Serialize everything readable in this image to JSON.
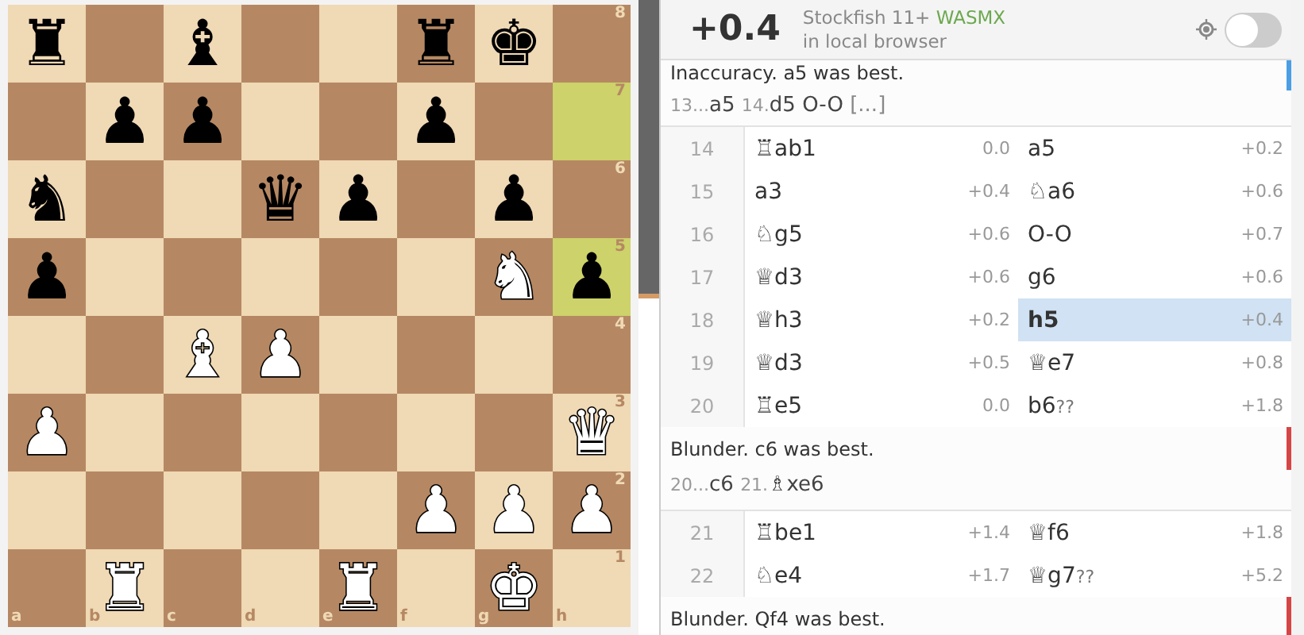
{
  "board": {
    "ranks": [
      {
        "label": "8",
        "squares": [
          {
            "piece": "♜",
            "white": false,
            "highlighted": false
          },
          {
            "highlighted": false
          },
          {
            "piece": "♝",
            "white": false,
            "highlighted": false
          },
          {
            "highlighted": false
          },
          {
            "highlighted": false
          },
          {
            "piece": "♜",
            "white": false,
            "highlighted": false
          },
          {
            "piece": "♚",
            "white": false,
            "highlighted": false
          },
          {
            "highlighted": false
          }
        ]
      },
      {
        "label": "7",
        "squares": [
          {
            "highlighted": false
          },
          {
            "piece": "♟",
            "white": false,
            "highlighted": false
          },
          {
            "piece": "♟",
            "white": false,
            "highlighted": false
          },
          {
            "highlighted": false
          },
          {
            "highlighted": false
          },
          {
            "piece": "♟",
            "white": false,
            "highlighted": false
          },
          {
            "highlighted": false
          },
          {
            "highlighted": true
          }
        ]
      },
      {
        "label": "6",
        "squares": [
          {
            "piece": "♞",
            "white": false,
            "highlighted": false
          },
          {
            "highlighted": false
          },
          {
            "highlighted": false
          },
          {
            "piece": "♛",
            "white": false,
            "highlighted": false
          },
          {
            "piece": "♟",
            "white": false,
            "highlighted": false
          },
          {
            "highlighted": false
          },
          {
            "piece": "♟",
            "white": false,
            "highlighted": false
          },
          {
            "highlighted": false
          }
        ]
      },
      {
        "label": "5",
        "squares": [
          {
            "piece": "♟",
            "white": false,
            "highlighted": false
          },
          {
            "highlighted": false
          },
          {
            "highlighted": false
          },
          {
            "highlighted": false
          },
          {
            "highlighted": false
          },
          {
            "highlighted": false
          },
          {
            "piece": "♞",
            "white": true,
            "highlighted": false
          },
          {
            "piece": "♟",
            "white": false,
            "highlighted": true
          }
        ]
      },
      {
        "label": "4",
        "squares": [
          {
            "highlighted": false
          },
          {
            "highlighted": false
          },
          {
            "piece": "♝",
            "white": true,
            "highlighted": false
          },
          {
            "piece": "♟",
            "white": true,
            "highlighted": false
          },
          {
            "highlighted": false
          },
          {
            "highlighted": false
          },
          {
            "highlighted": false
          },
          {
            "highlighted": false
          }
        ]
      },
      {
        "label": "3",
        "squares": [
          {
            "piece": "♟",
            "white": true,
            "highlighted": false
          },
          {
            "highlighted": false
          },
          {
            "highlighted": false
          },
          {
            "highlighted": false
          },
          {
            "highlighted": false
          },
          {
            "highlighted": false
          },
          {
            "highlighted": false
          },
          {
            "piece": "♛",
            "white": true,
            "highlighted": false
          }
        ]
      },
      {
        "label": "2",
        "squares": [
          {
            "highlighted": false
          },
          {
            "highlighted": false
          },
          {
            "highlighted": false
          },
          {
            "highlighted": false
          },
          {
            "highlighted": false
          },
          {
            "piece": "♟",
            "white": true,
            "highlighted": false
          },
          {
            "piece": "♟",
            "white": true,
            "highlighted": false
          },
          {
            "piece": "♟",
            "white": true,
            "highlighted": false
          }
        ]
      },
      {
        "label": "1",
        "squares": [
          {
            "highlighted": false
          },
          {
            "piece": "♜",
            "white": true,
            "highlighted": false
          },
          {
            "highlighted": false
          },
          {
            "highlighted": false
          },
          {
            "piece": "♜",
            "white": true,
            "highlighted": false
          },
          {
            "highlighted": false
          },
          {
            "piece": "♚",
            "white": true,
            "highlighted": false
          },
          {
            "highlighted": false
          }
        ]
      }
    ],
    "files": [
      "a",
      "b",
      "c",
      "d",
      "e",
      "f",
      "g",
      "h"
    ]
  },
  "eval_bar": {
    "level": 0.53
  },
  "engine": {
    "eval": "+0.4",
    "name": "Stockfish 11+",
    "variant": "WASMX",
    "location": "in local browser",
    "enabled": false
  },
  "moves": [
    {
      "kind": "comment",
      "color": "#4a9ee3",
      "text": "Inaccuracy. a5 was best.",
      "line": [
        {
          "kind": "num",
          "text": "13..."
        },
        {
          "kind": "san",
          "text": "a5"
        },
        {
          "kind": "num",
          "text": "14."
        },
        {
          "kind": "san",
          "text": "d5"
        },
        {
          "kind": "san",
          "text": "O-O"
        },
        {
          "kind": "more",
          "text": "[...]"
        }
      ]
    },
    {
      "kind": "row",
      "number": "14",
      "white": {
        "san": "♖ab1",
        "eval": "0.0",
        "selected": false
      },
      "black": {
        "san": "a5",
        "eval": "+0.2",
        "selected": false
      }
    },
    {
      "kind": "row",
      "number": "15",
      "white": {
        "san": "a3",
        "eval": "+0.4",
        "selected": false
      },
      "black": {
        "san": "♘a6",
        "eval": "+0.6",
        "selected": false
      }
    },
    {
      "kind": "row",
      "number": "16",
      "white": {
        "san": "♘g5",
        "eval": "+0.6",
        "selected": false
      },
      "black": {
        "san": "O-O",
        "eval": "+0.7",
        "selected": false
      }
    },
    {
      "kind": "row",
      "number": "17",
      "white": {
        "san": "♕d3",
        "eval": "+0.6",
        "selected": false
      },
      "black": {
        "san": "g6",
        "eval": "+0.6",
        "selected": false
      }
    },
    {
      "kind": "row",
      "number": "18",
      "white": {
        "san": "♕h3",
        "eval": "+0.2",
        "selected": false
      },
      "black": {
        "san": "h5",
        "eval": "+0.4",
        "selected": true
      }
    },
    {
      "kind": "row",
      "number": "19",
      "white": {
        "san": "♕d3",
        "eval": "+0.5",
        "selected": false
      },
      "black": {
        "san": "♕e7",
        "eval": "+0.8",
        "selected": false
      }
    },
    {
      "kind": "row",
      "number": "20",
      "white": {
        "san": "♖e5",
        "eval": "0.0",
        "selected": false
      },
      "black": {
        "san": "b6",
        "annotation": "??",
        "eval": "+1.8",
        "selected": false
      }
    },
    {
      "kind": "comment",
      "color": "#d64545",
      "text": "Blunder. c6 was best.",
      "line": [
        {
          "kind": "num",
          "text": "20..."
        },
        {
          "kind": "san",
          "text": "c6"
        },
        {
          "kind": "num",
          "text": "21."
        },
        {
          "kind": "san",
          "text": "♗xe6"
        }
      ]
    },
    {
      "kind": "row",
      "number": "21",
      "white": {
        "san": "♖be1",
        "eval": "+1.4",
        "selected": false
      },
      "black": {
        "san": "♕f6",
        "eval": "+1.8",
        "selected": false
      }
    },
    {
      "kind": "row",
      "number": "22",
      "white": {
        "san": "♘e4",
        "eval": "+1.7",
        "selected": false
      },
      "black": {
        "san": "♕g7",
        "annotation": "??",
        "eval": "+5.2",
        "selected": false
      }
    },
    {
      "kind": "comment",
      "color": "#d64545",
      "text": "Blunder. Qf4 was best."
    }
  ]
}
